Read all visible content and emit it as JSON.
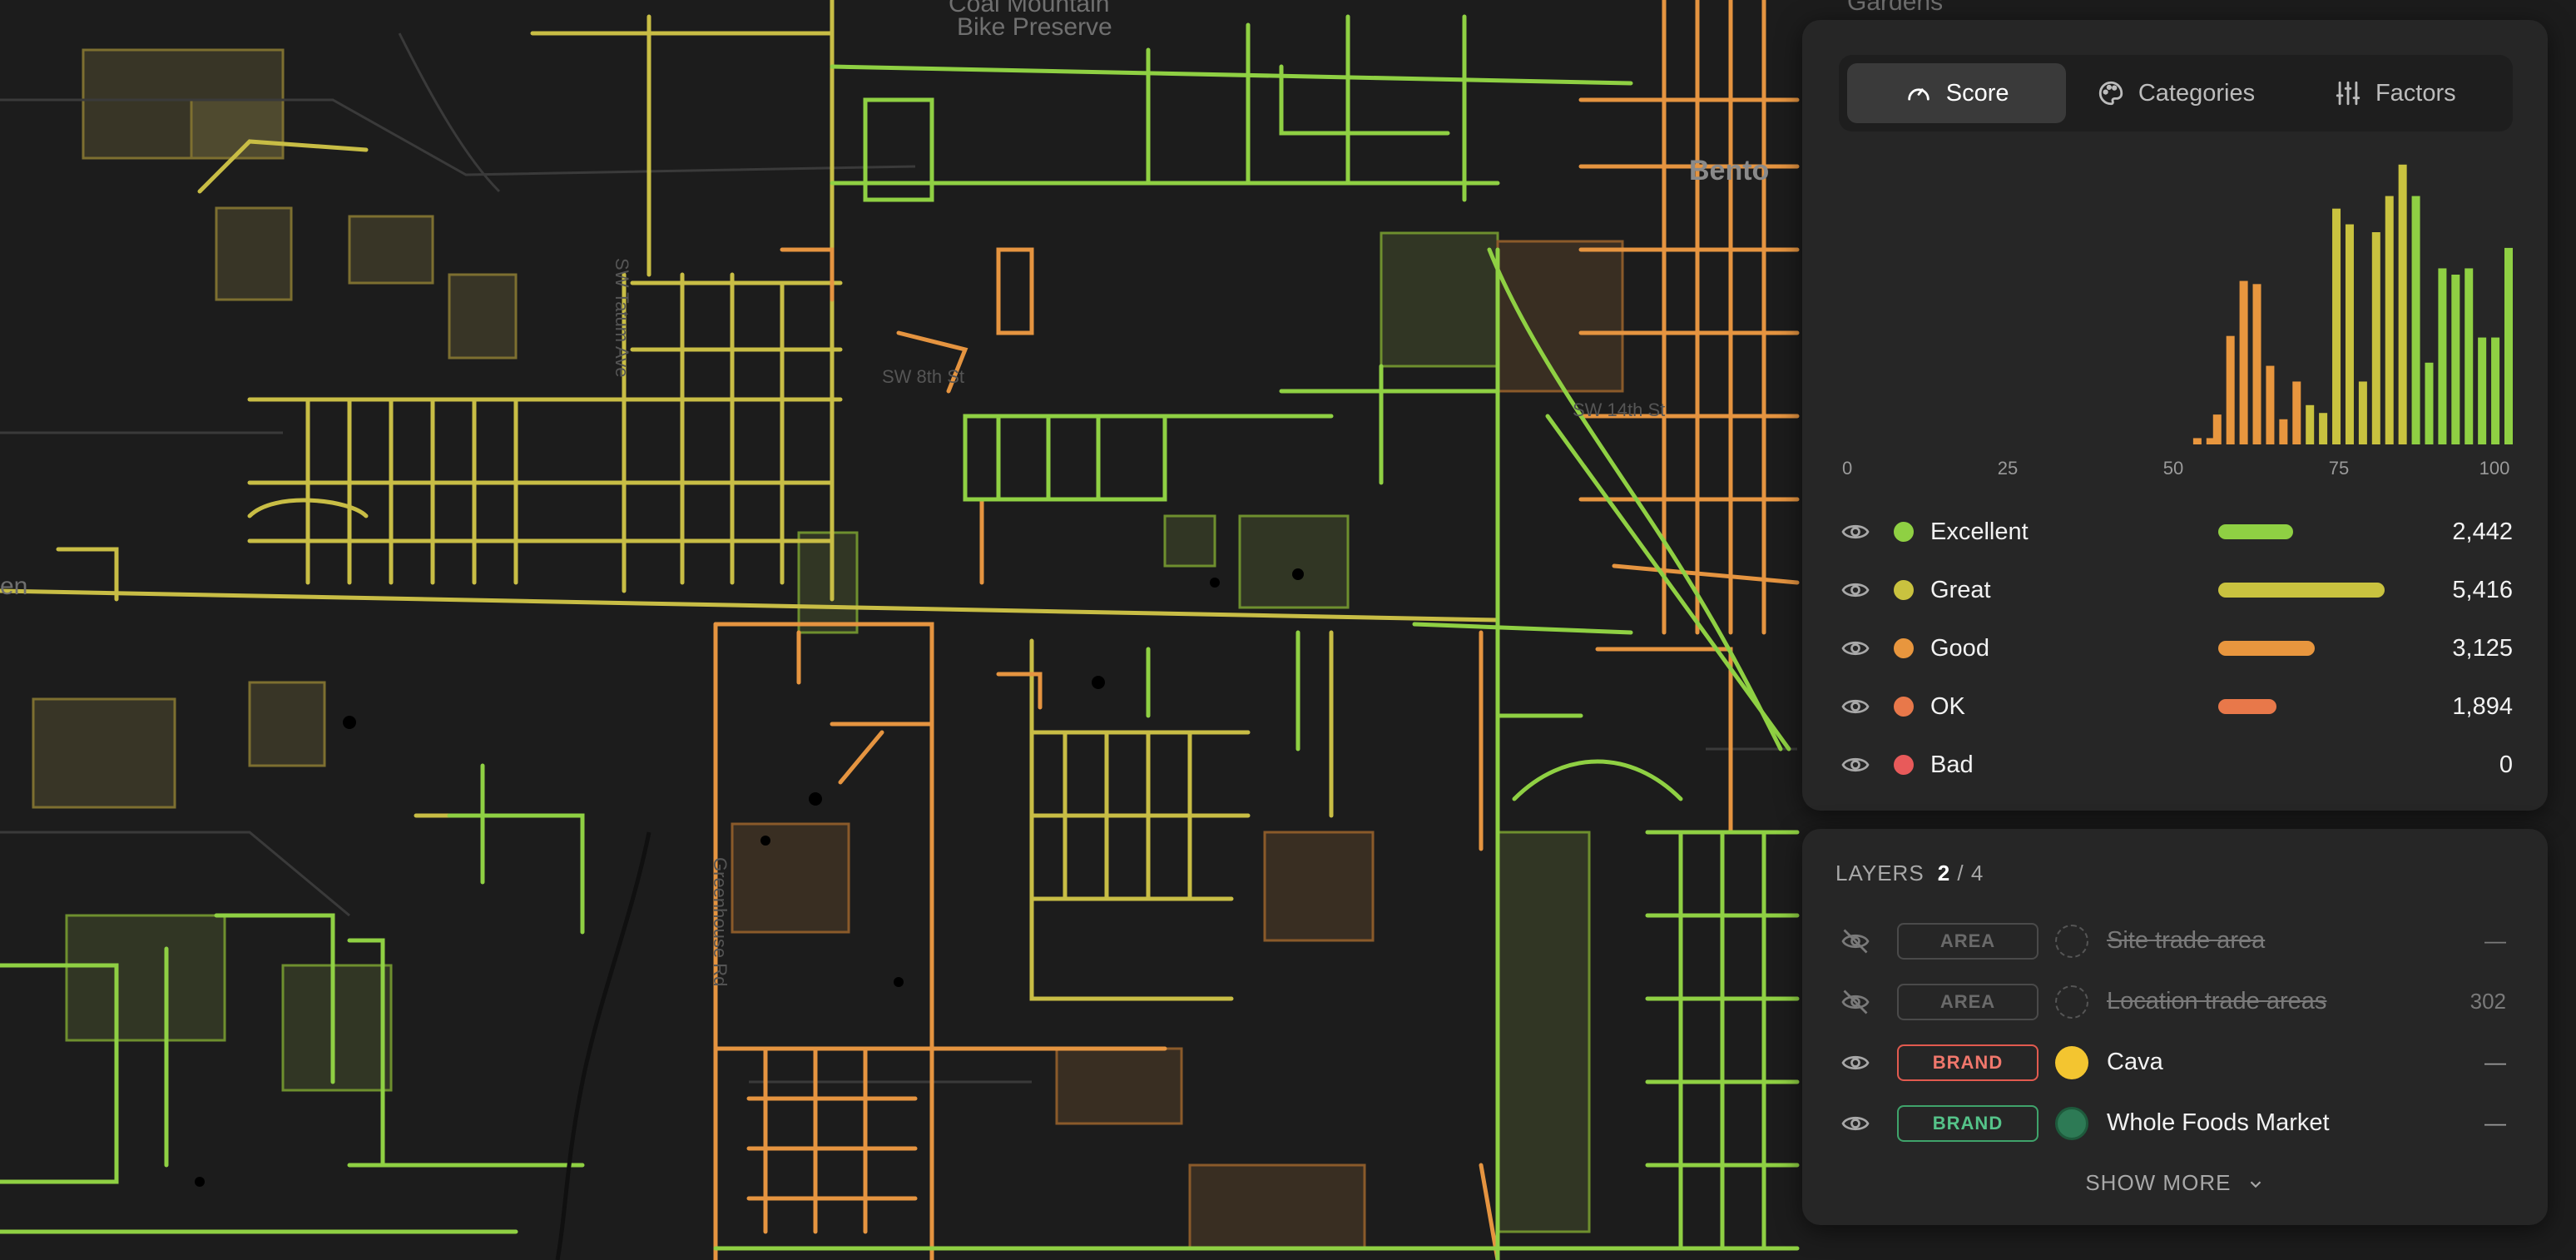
{
  "map": {
    "labels": [
      {
        "text": "Coal Mountain",
        "kind": "poi"
      },
      {
        "text": "Bike Preserve",
        "kind": "poi"
      },
      {
        "text": "Gardens",
        "kind": "poi"
      },
      {
        "text": "Bento",
        "kind": "town"
      },
      {
        "text": "SW Tatum Ave",
        "kind": "street"
      },
      {
        "text": "SW 8th St",
        "kind": "street"
      },
      {
        "text": "SW 14th St",
        "kind": "street"
      },
      {
        "text": "Greenhouse Rd",
        "kind": "street"
      },
      {
        "text": "en",
        "kind": "edge"
      }
    ]
  },
  "tabs": [
    {
      "label": "Score",
      "icon": "gauge-icon",
      "active": true
    },
    {
      "label": "Categories",
      "icon": "palette-icon",
      "active": false
    },
    {
      "label": "Factors",
      "icon": "sliders-icon",
      "active": false
    }
  ],
  "chart_data": {
    "type": "bar",
    "x_ticks": [
      "0",
      "25",
      "50",
      "75",
      "100"
    ],
    "xlim": [
      0,
      100
    ],
    "x": [
      44,
      46,
      51,
      53,
      55,
      56,
      58,
      60,
      62,
      64,
      66,
      68,
      70,
      72,
      74,
      76,
      78,
      80,
      82,
      84,
      86,
      88,
      90,
      92,
      94,
      96,
      98,
      100
    ],
    "values": [
      4,
      4,
      19,
      69,
      104,
      102,
      50,
      16,
      40,
      25,
      20,
      150,
      140,
      40,
      135,
      158,
      178,
      158,
      52,
      112,
      108,
      112,
      68,
      68,
      125
    ],
    "grid": false,
    "colors": {
      "bad": "#e85a5a",
      "ok": "#e8784a",
      "good": "#e8963e",
      "great": "#c9c23f",
      "excellent": "#8fd043"
    }
  },
  "legend": [
    {
      "label": "Excellent",
      "color": "#8fd043",
      "count": "2,442",
      "share": 0.45
    },
    {
      "label": "Great",
      "color": "#c9c23f",
      "count": "5,416",
      "share": 1.0
    },
    {
      "label": "Good",
      "color": "#e8963e",
      "count": "3,125",
      "share": 0.58
    },
    {
      "label": "OK",
      "color": "#e8784a",
      "count": "1,894",
      "share": 0.35
    },
    {
      "label": "Bad",
      "color": "#e85a5a",
      "count": "0",
      "share": 0
    }
  ],
  "layers": {
    "title": "LAYERS",
    "active_count": "2",
    "total": "/ 4",
    "items": [
      {
        "badge": "AREA",
        "name": "Site trade area",
        "count": "—",
        "visible": false,
        "icon": "dashed-circle-icon"
      },
      {
        "badge": "AREA",
        "name": "Location trade areas",
        "count": "302",
        "visible": false,
        "icon": "dashed-circle-icon"
      },
      {
        "badge": "BRAND",
        "name": "Cava",
        "count": "—",
        "visible": true,
        "icon": "cava-logo-icon"
      },
      {
        "badge": "BRAND",
        "name": "Whole Foods Market",
        "count": "—",
        "visible": true,
        "icon": "whole-foods-logo-icon"
      }
    ],
    "show_more": "SHOW MORE"
  }
}
